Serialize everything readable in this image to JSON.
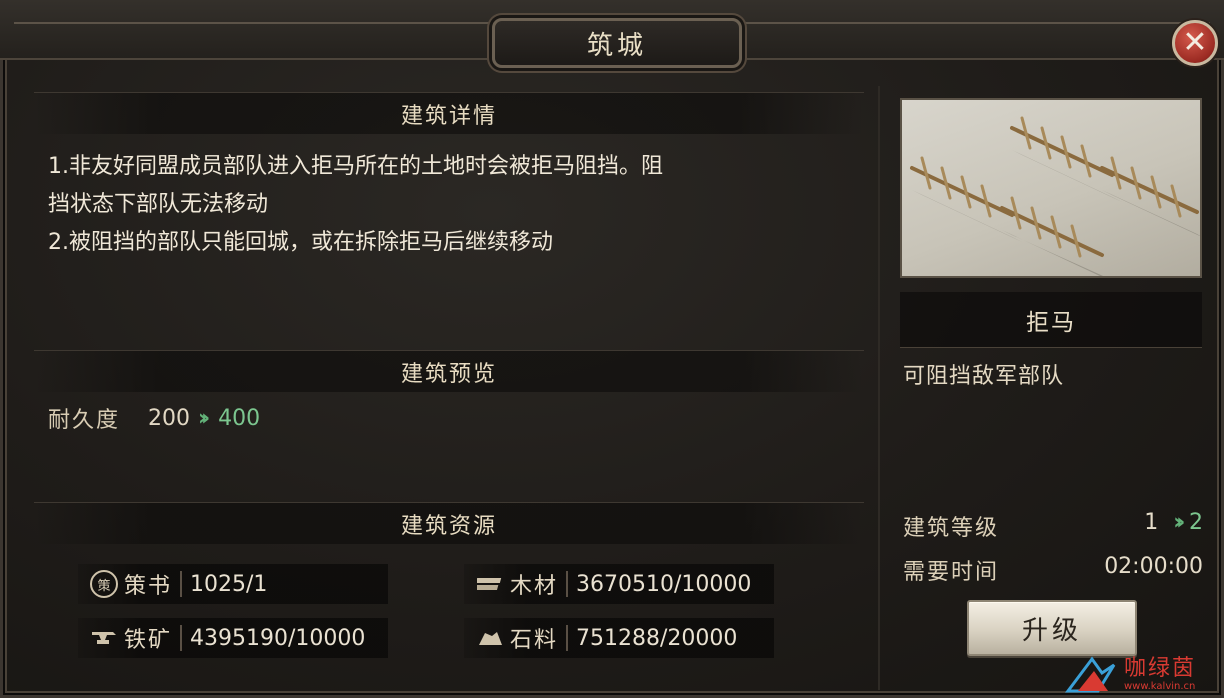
{
  "window": {
    "title": "筑城",
    "close_label": "✕"
  },
  "details": {
    "title": "建筑详情",
    "lines": [
      "1.非友好同盟成员部队进入拒马所在的土地时会被拒马阻挡。阻",
      "挡状态下部队无法移动",
      "2.被阻挡的部队只能回城，或在拆除拒马后继续移动"
    ]
  },
  "preview": {
    "title": "建筑预览",
    "durability_label": "耐久度",
    "current": "200",
    "next": "400"
  },
  "resources": {
    "title": "建筑资源",
    "items": [
      {
        "icon": "book-icon",
        "glyph": "策",
        "name": "策书",
        "value": "1025/1"
      },
      {
        "icon": "wood-icon",
        "glyph": "",
        "name": "木材",
        "value": "3670510/10000"
      },
      {
        "icon": "anvil-icon",
        "glyph": "",
        "name": "铁矿",
        "value": "4395190/10000"
      },
      {
        "icon": "stone-icon",
        "glyph": "",
        "name": "石料",
        "value": "751288/20000"
      }
    ]
  },
  "building": {
    "name": "拒马",
    "description": "可阻挡敌军部队",
    "level_label": "建筑等级",
    "level_current": "1",
    "level_next": "2",
    "time_label": "需要时间",
    "time_value": "02:00:00",
    "upgrade_label": "升级"
  },
  "watermark": {
    "name": "咖绿茵",
    "url": "www.kalvin.cn"
  },
  "colors": {
    "accent_green": "#7cc68f",
    "close_red": "#b8362b",
    "panel_dark": "#1f1c19"
  }
}
